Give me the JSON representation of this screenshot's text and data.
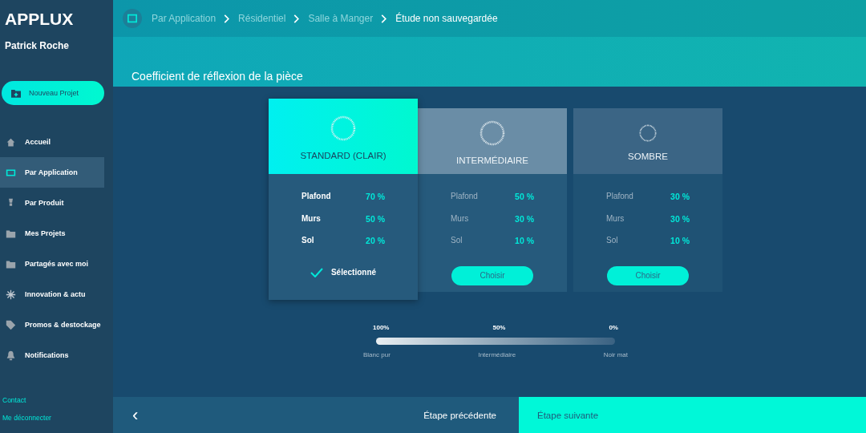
{
  "sidebar": {
    "logo": "APPLUX",
    "user": "Patrick Roche",
    "new_project": "Nouveau Projet",
    "items": [
      {
        "label": "Accueil",
        "selected": false
      },
      {
        "label": "Par Application",
        "selected": true
      },
      {
        "label": "Par Produit",
        "selected": false
      },
      {
        "label": "Mes Projets",
        "selected": false
      },
      {
        "label": "Partagés avec moi",
        "selected": false
      },
      {
        "label": "Innovation & actu",
        "selected": false
      },
      {
        "label": "Promos & destockage",
        "selected": false
      },
      {
        "label": "Notifications",
        "selected": false
      }
    ],
    "links": [
      "Contact",
      "Me déconnecter"
    ]
  },
  "breadcrumb": [
    "Par Application",
    "Résidentiel",
    "Salle à Manger",
    "Étude non sauvegardée"
  ],
  "section_title": "Coefficient de réflexion de la pièce",
  "options": [
    {
      "title": "STANDARD (CLAIR)",
      "selected": true,
      "color": "#00f0f0",
      "rows": [
        {
          "label": "Plafond",
          "value": "70 %"
        },
        {
          "label": "Murs",
          "value": "50 %"
        },
        {
          "label": "Sol",
          "value": "20 %"
        }
      ],
      "action": "Sélectionné"
    },
    {
      "title": "INTERMÉDIAIRE",
      "selected": false,
      "color": "#6a8da6",
      "rows": [
        {
          "label": "Plafond",
          "value": "50 %"
        },
        {
          "label": "Murs",
          "value": "30 %"
        },
        {
          "label": "Sol",
          "value": "10 %"
        }
      ],
      "action": "Choisir"
    },
    {
      "title": "SOMBRE",
      "selected": false,
      "color": "#3b6585",
      "rows": [
        {
          "label": "Plafond",
          "value": "30 %"
        },
        {
          "label": "Murs",
          "value": "30 %"
        },
        {
          "label": "Sol",
          "value": "10 %"
        }
      ],
      "action": "Choisir"
    }
  ],
  "scale": {
    "top_labels": [
      "100%",
      "50%",
      "0%"
    ],
    "bottom_labels": [
      "Blanc pur",
      "Intermédiaire",
      "Noir mat"
    ]
  },
  "footer": {
    "back": "‹",
    "previous": "Étape précédente",
    "next": "Étape suivante"
  }
}
